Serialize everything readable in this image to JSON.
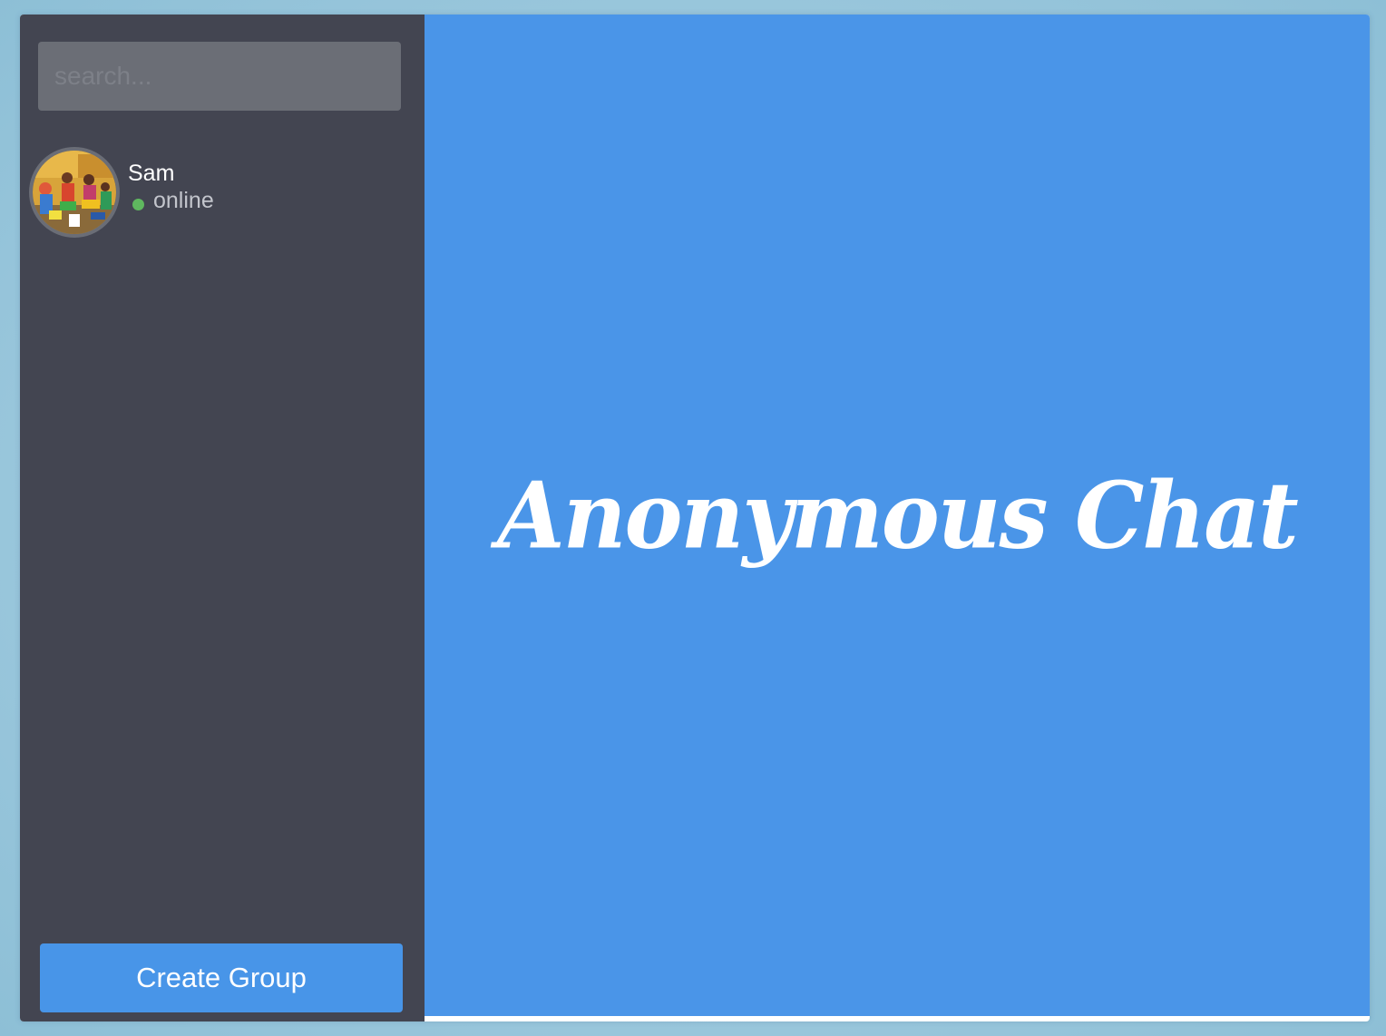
{
  "search": {
    "placeholder": "search..."
  },
  "contacts": [
    {
      "name": "Sam",
      "status": "online",
      "status_color": "#5fb85f"
    }
  ],
  "sidebar": {
    "create_group_label": "Create Group"
  },
  "main": {
    "title": "Anonymous Chat"
  },
  "colors": {
    "sidebar_bg": "#434551",
    "accent": "#4a95e8",
    "search_bg": "#6b6e76"
  }
}
